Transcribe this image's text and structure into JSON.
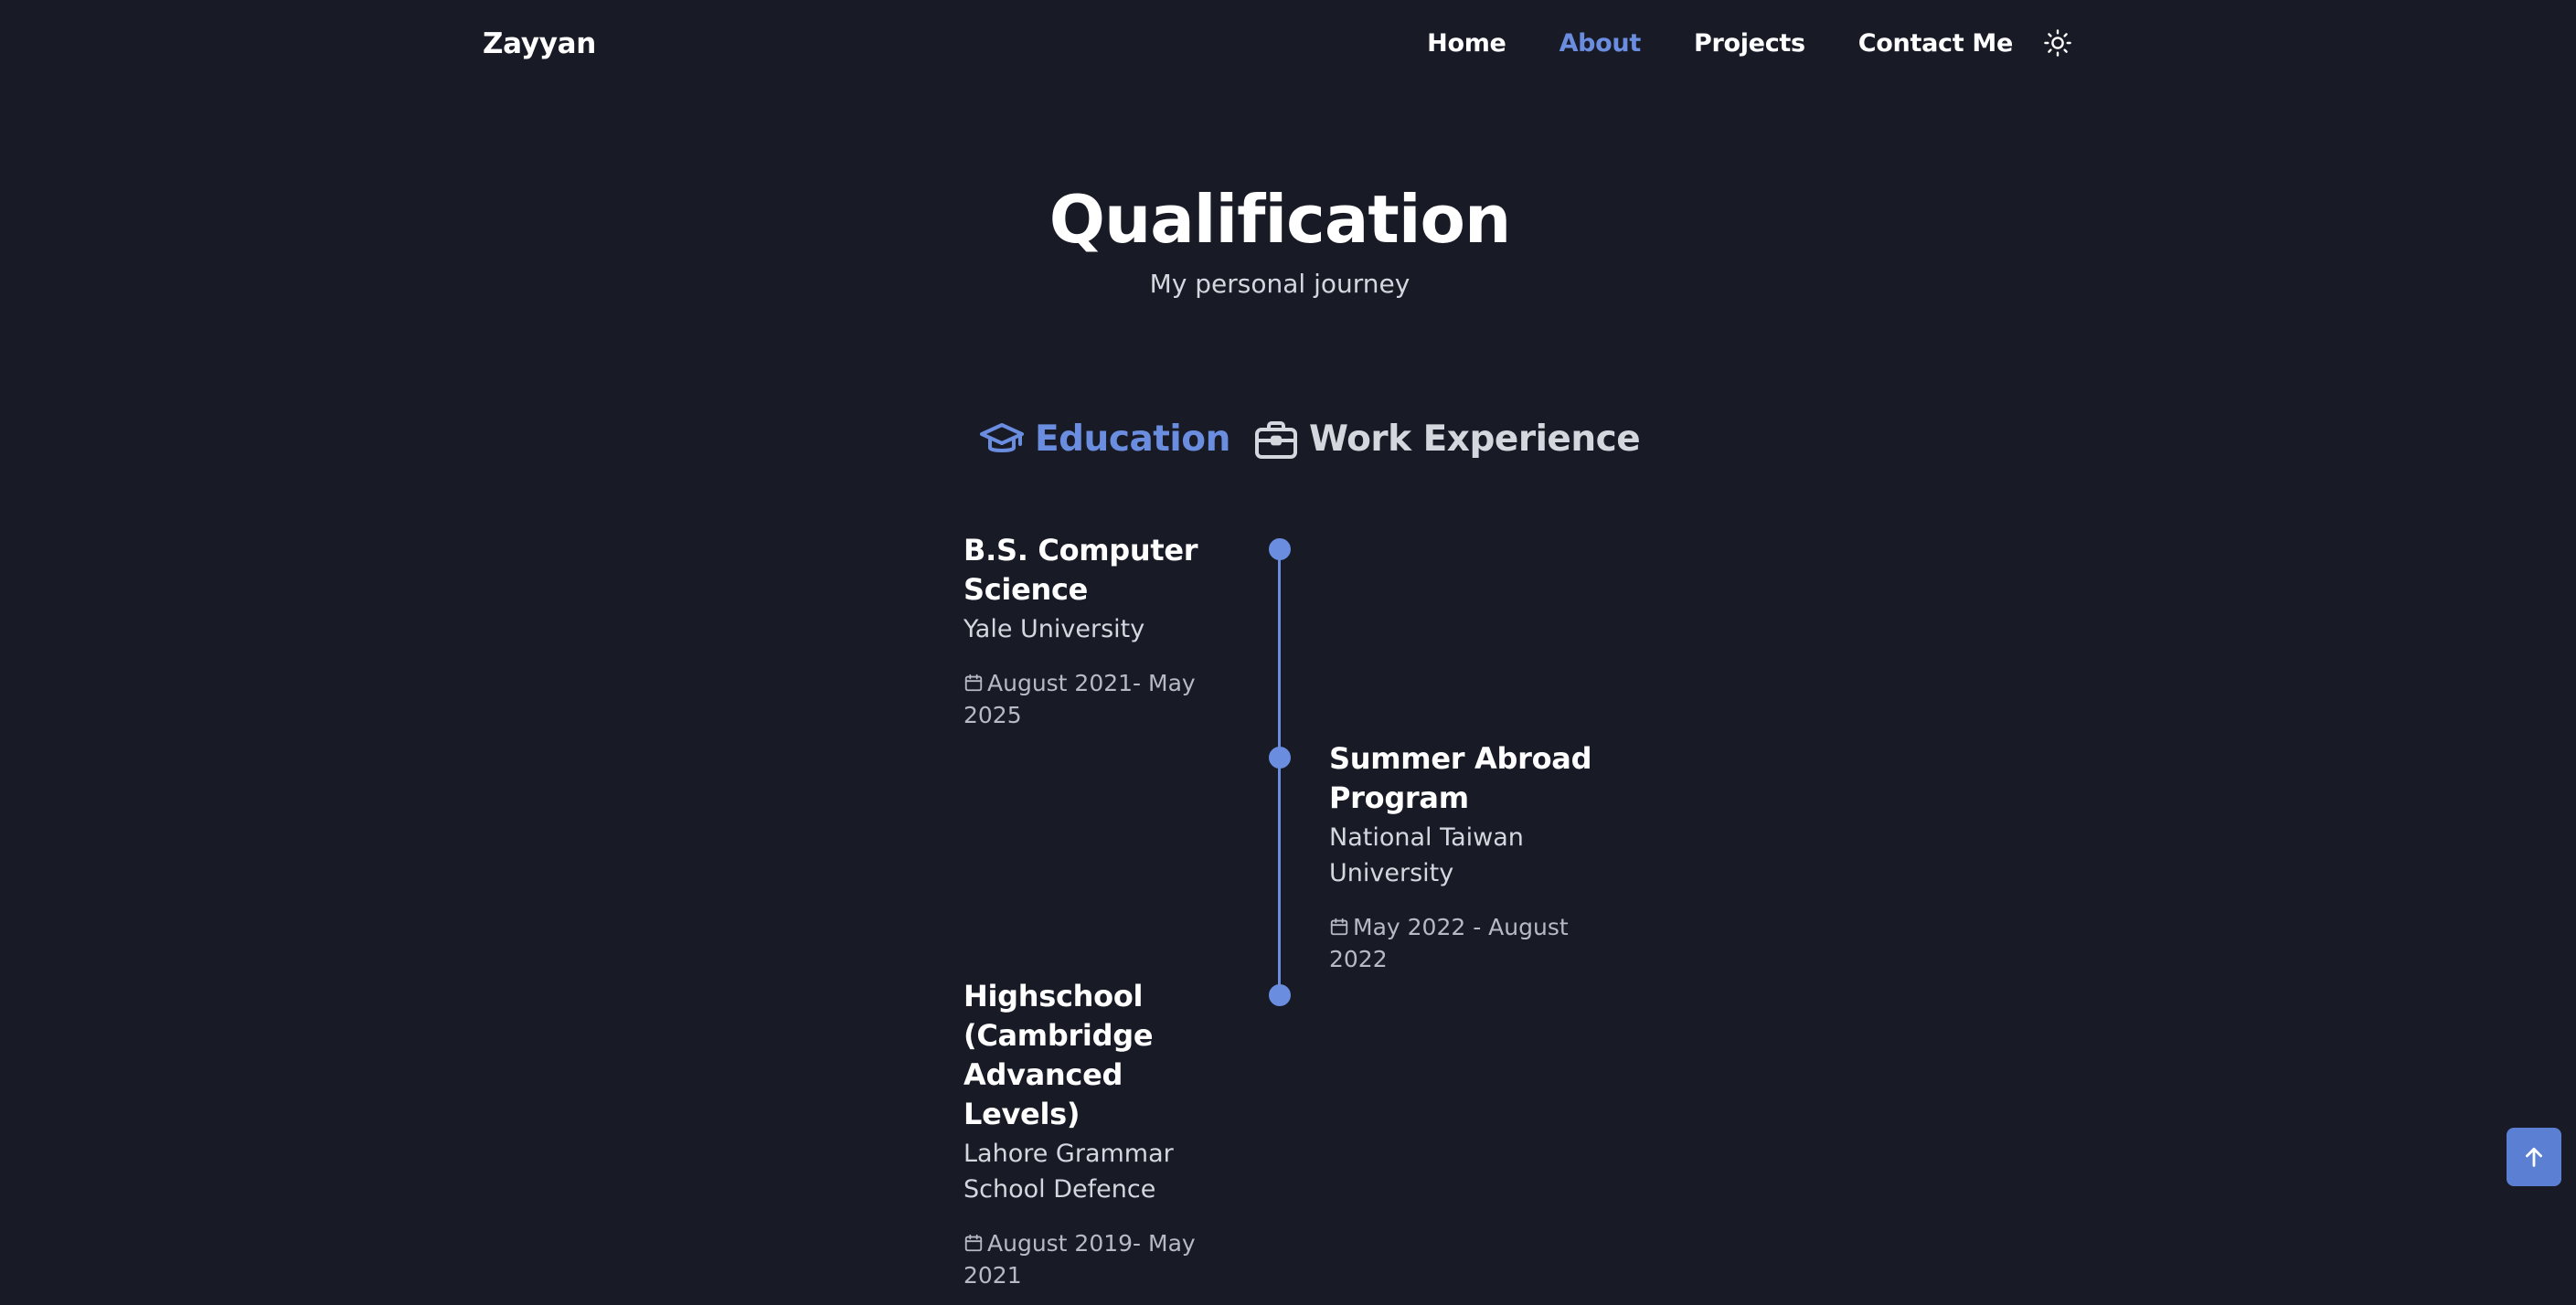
{
  "header": {
    "brand": "Zayyan",
    "nav": [
      {
        "label": "Home",
        "active": false
      },
      {
        "label": "About",
        "active": true
      },
      {
        "label": "Projects",
        "active": false
      },
      {
        "label": "Contact Me",
        "active": false
      }
    ],
    "theme_icon": "sun-icon"
  },
  "section": {
    "title": "Qualification",
    "subtitle": "My personal journey"
  },
  "tabs": [
    {
      "label": "Education",
      "icon": "graduation-cap-icon",
      "active": true
    },
    {
      "label": "Work Experience",
      "icon": "briefcase-icon",
      "active": false
    }
  ],
  "qualifications": [
    {
      "title": "B.S. Computer Science",
      "subtitle": "Yale University",
      "date": "August 2021- May 2025",
      "side": "left"
    },
    {
      "title": "Summer Abroad Program",
      "subtitle": "National Taiwan University",
      "date": "May 2022 - August 2022",
      "side": "right"
    },
    {
      "title": "Highschool (Cambridge Advanced Levels)",
      "subtitle": "Lahore Grammar School Defence",
      "date": "August 2019- May 2021",
      "side": "left"
    }
  ],
  "icons": {
    "calendar": "calendar-icon",
    "scroll_up": "arrow-up-icon"
  },
  "colors": {
    "background": "#181b25",
    "accent": "#6a8de0",
    "text": "#ffffff",
    "muted": "#d5d7de"
  }
}
